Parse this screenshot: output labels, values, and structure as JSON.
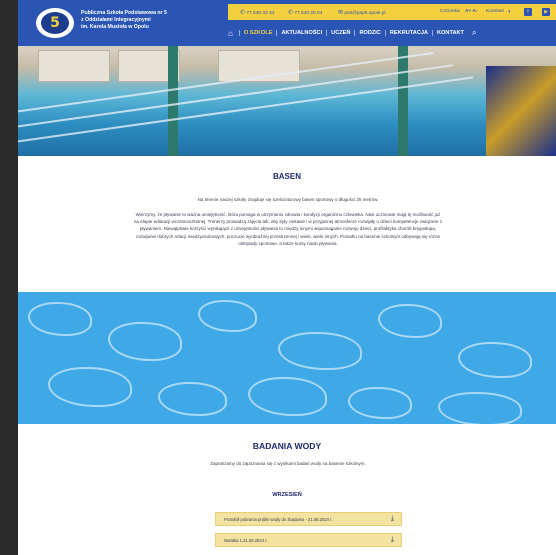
{
  "header": {
    "logo_text": "5",
    "school_name_lines": [
      "Publiczna Szkoła Podstawowa nr 5",
      "z Oddziałami Integracyjnymi",
      "im. Karola Musioła w Opolu"
    ],
    "phone1": "77 540 33 33",
    "phone2": "77 540 28 04",
    "email": "ps5@psp5.opole.pl",
    "font_size_label": "Czcionka",
    "font_size_controls": "A+ A-",
    "contrast_label": "Kontrast"
  },
  "nav": {
    "items": [
      {
        "label": "O SZKOLE",
        "active": true
      },
      {
        "label": "AKTUALNOŚCI",
        "active": false
      },
      {
        "label": "UCZEŃ",
        "active": false
      },
      {
        "label": "RODZIC",
        "active": false
      },
      {
        "label": "REKRUTACJA",
        "active": false
      },
      {
        "label": "KONTAKT",
        "active": false
      }
    ]
  },
  "basen": {
    "title": "BASEN",
    "paragraph1": "Na terenie naszej szkoły znajduje się sześciotorowy basen sportowy o długości 25 metrów.",
    "paragraph2": "Wierzymy, że pływanie to ważna umiejętność, która pomaga w utrzymaniu zdrowia i kondycji organizmu człowieka. Nasi uczniowie mają tę możliwość już na etapie edukacji wczesnoszkolnej. Trenerzy prowadzą zajęcia tak, aby były ciekawe i w przyjaznej atmosferze rozwijały u dzieci kompetencje związane z pływaniem. Niewątpliwie korzyści wynikające z umiejętności pływania to między innymi wspomaganie rozwoju dzieci, profilaktyka chorób kręgosłupa, rozwijanie dobrych relacji międzyosobowych, poczucie wyobraźnej przestrzennej i wiele, wiele innych. Ponadto na basenie szkolnym odbywają się różne olimpiady sportowe, a także kursy nauki pływania."
  },
  "badania": {
    "title": "BADANIA WODY",
    "intro": "Zapraszamy do zapoznania się z wynikami badań wody na basenie szkolnym.",
    "month": "WRZESIEŃ",
    "docs": [
      "Protokół pobrania próbki wody do zbadania - 21.08.2024 r.",
      "Notatka 1.21.08.2024 r."
    ]
  },
  "colors": {
    "brand_blue": "#2b55b4",
    "accent_yellow": "#f4d03f",
    "heading_navy": "#1e2a6b",
    "doc_bg": "#f3e3a1"
  },
  "icons": [
    "phone-icon",
    "email-icon",
    "contrast-icon",
    "facebook-icon",
    "youtube-icon",
    "home-icon",
    "search-icon",
    "download-icon"
  ]
}
